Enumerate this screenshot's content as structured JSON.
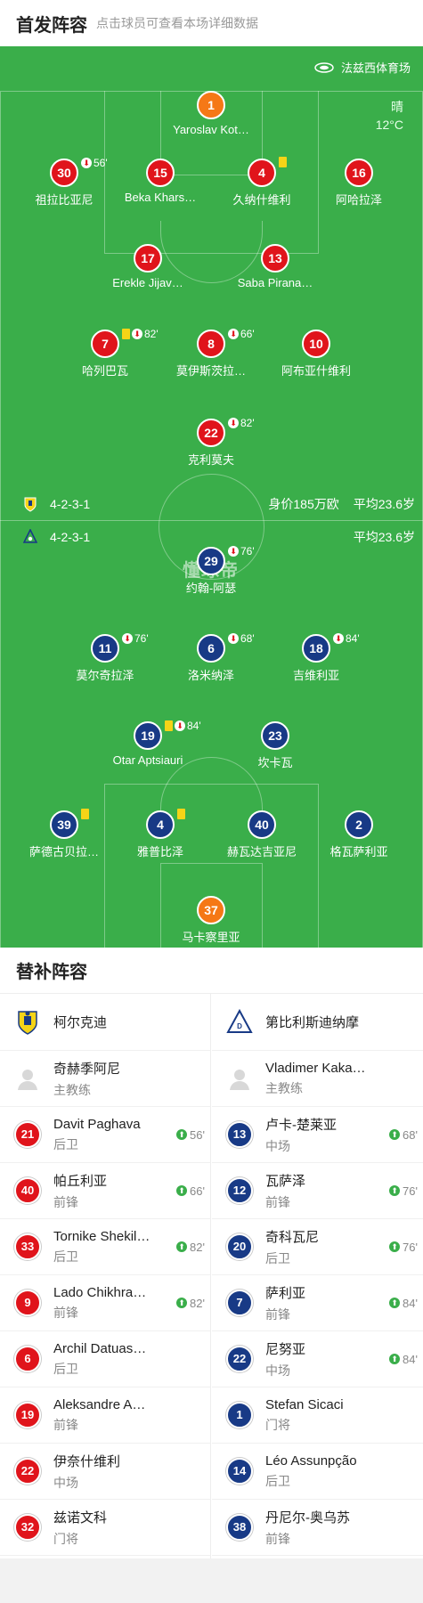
{
  "header": {
    "title": "首发阵容",
    "subtitle": "点击球员可查看本场详细数据"
  },
  "pitch": {
    "venue": "法兹西体育场",
    "weather": "晴",
    "temperature": "12°C",
    "watermark": "懂球帝",
    "home_row": {
      "formation": "4-2-3-1",
      "value": "身价185万欧",
      "avg_age": "平均23.6岁"
    },
    "away_row": {
      "formation": "4-2-3-1",
      "avg_age": "平均23.6岁"
    }
  },
  "home_players": [
    {
      "num": "1",
      "name": "Yaroslav Kot…",
      "gk": true
    },
    {
      "num": "30",
      "name": "祖拉比亚尼",
      "sub": "56'"
    },
    {
      "num": "15",
      "name": "Beka Khars…"
    },
    {
      "num": "4",
      "name": "久纳什维利",
      "card": true
    },
    {
      "num": "16",
      "name": "阿哈拉泽"
    },
    {
      "num": "17",
      "name": "Erekle Jijav…"
    },
    {
      "num": "13",
      "name": "Saba Pirana…"
    },
    {
      "num": "7",
      "name": "哈列巴瓦",
      "card": true,
      "sub": "82'"
    },
    {
      "num": "8",
      "name": "莫伊斯茨拉…",
      "sub": "66'"
    },
    {
      "num": "10",
      "name": "阿布亚什维利"
    },
    {
      "num": "22",
      "name": "克利莫夫",
      "sub": "82'"
    }
  ],
  "away_players": [
    {
      "num": "29",
      "name": "约翰-阿瑟",
      "sub": "76'"
    },
    {
      "num": "11",
      "name": "莫尔奇拉泽",
      "sub": "76'"
    },
    {
      "num": "6",
      "name": "洛米纳泽",
      "sub": "68'"
    },
    {
      "num": "18",
      "name": "吉维利亚",
      "sub": "84'"
    },
    {
      "num": "19",
      "name": "Otar Aptsiauri",
      "card": true,
      "sub": "84'"
    },
    {
      "num": "23",
      "name": "坎卡瓦"
    },
    {
      "num": "39",
      "name": "萨德古贝拉…",
      "card": true
    },
    {
      "num": "4",
      "name": "雅普比泽",
      "card": true
    },
    {
      "num": "40",
      "name": "赫瓦达吉亚尼"
    },
    {
      "num": "2",
      "name": "格瓦萨利亚"
    },
    {
      "num": "37",
      "name": "马卡察里亚",
      "gk": true
    }
  ],
  "subs": {
    "title": "替补阵容",
    "home": {
      "team": "柯尔克迪",
      "coach_name": "奇赫季阿尼",
      "coach_role": "主教练",
      "players": [
        {
          "num": "21",
          "name": "Davit Paghava",
          "pos": "后卫",
          "on": "56'"
        },
        {
          "num": "40",
          "name": "帕丘利亚",
          "pos": "前锋",
          "on": "66'"
        },
        {
          "num": "33",
          "name": "Tornike Shekil…",
          "pos": "后卫",
          "on": "82'"
        },
        {
          "num": "9",
          "name": "Lado Chikhra…",
          "pos": "前锋",
          "on": "82'"
        },
        {
          "num": "6",
          "name": "Archil Datuas…",
          "pos": "后卫"
        },
        {
          "num": "19",
          "name": "Aleksandre A…",
          "pos": "前锋"
        },
        {
          "num": "22",
          "name": "伊奈什维利",
          "pos": "中场"
        },
        {
          "num": "32",
          "name": "兹诺文科",
          "pos": "门将"
        }
      ]
    },
    "away": {
      "team": "第比利斯迪纳摩",
      "coach_name": "Vladimer Kakashvili",
      "coach_role": "主教练",
      "players": [
        {
          "num": "13",
          "name": "卢卡-楚莱亚",
          "pos": "中场",
          "on": "68'"
        },
        {
          "num": "12",
          "name": "瓦萨泽",
          "pos": "前锋",
          "on": "76'"
        },
        {
          "num": "20",
          "name": "奇科瓦尼",
          "pos": "后卫",
          "on": "76'"
        },
        {
          "num": "7",
          "name": "萨利亚",
          "pos": "前锋",
          "on": "84'"
        },
        {
          "num": "22",
          "name": "尼努亚",
          "pos": "中场",
          "on": "84'"
        },
        {
          "num": "1",
          "name": "Stefan Sicaci",
          "pos": "门将"
        },
        {
          "num": "14",
          "name": "Léo Assunpção",
          "pos": "后卫"
        },
        {
          "num": "38",
          "name": "丹尼尔-奥乌苏",
          "pos": "前锋"
        }
      ]
    }
  }
}
